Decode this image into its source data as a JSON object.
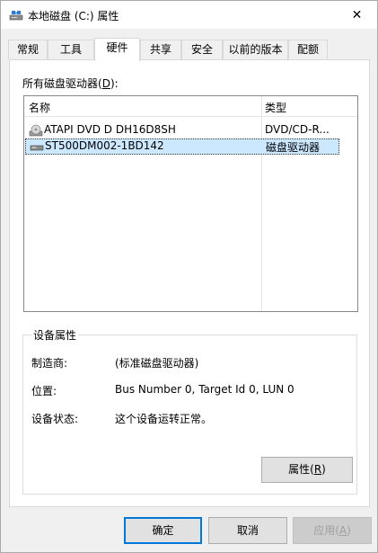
{
  "window": {
    "title": "本地磁盘 (C:) 属性",
    "close_glyph": "✕"
  },
  "tabs": [
    {
      "label": "常规",
      "active": false
    },
    {
      "label": "工具",
      "active": false
    },
    {
      "label": "硬件",
      "active": true
    },
    {
      "label": "共享",
      "active": false
    },
    {
      "label": "安全",
      "active": false
    },
    {
      "label": "以前的版本",
      "active": false
    },
    {
      "label": "配额",
      "active": false
    }
  ],
  "hardware": {
    "disks_label_pre": "所有磁盘驱动器(",
    "disks_label_key": "D",
    "disks_label_post": "):",
    "columns": {
      "name": "名称",
      "type": "类型"
    },
    "rows": [
      {
        "name": "ATAPI DVD D  DH16D8SH",
        "type": "DVD/CD-R...",
        "icon": "dvd-drive-icon",
        "selected": false
      },
      {
        "name": "ST500DM002-1BD142",
        "type": "磁盘驱动器",
        "icon": "hard-disk-icon",
        "selected": true
      }
    ],
    "device_props": {
      "title": "设备属性",
      "manufacturer_label": "制造商:",
      "manufacturer_value": "(标准磁盘驱动器)",
      "location_label": "位置:",
      "location_value": "Bus Number 0, Target Id 0, LUN 0",
      "status_label": "设备状态:",
      "status_value": "这个设备运转正常。"
    },
    "properties_button": {
      "pre": "属性(",
      "key": "R",
      "post": ")"
    }
  },
  "buttons": {
    "ok": "确定",
    "cancel": "取消",
    "apply_pre": "应用(",
    "apply_key": "A",
    "apply_post": ")"
  }
}
